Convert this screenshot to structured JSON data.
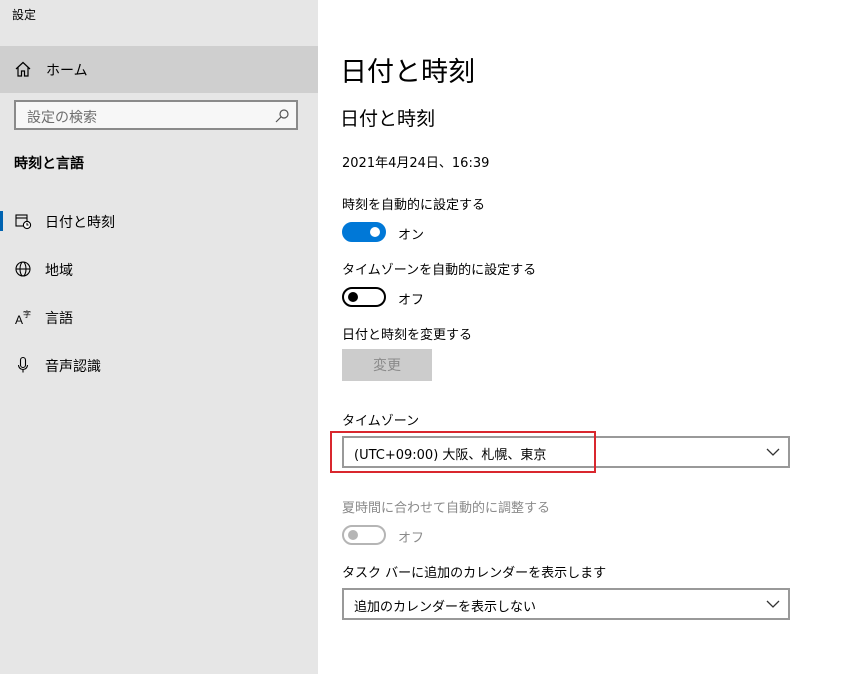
{
  "app": {
    "title": "設定"
  },
  "sidebar": {
    "home_label": "ホーム",
    "search_placeholder": "設定の検索",
    "section_title": "時刻と言語",
    "items": [
      {
        "label": "日付と時刻",
        "icon": "calendar-clock-icon",
        "selected": true
      },
      {
        "label": "地域",
        "icon": "globe-icon",
        "selected": false
      },
      {
        "label": "言語",
        "icon": "language-icon",
        "selected": false
      },
      {
        "label": "音声認識",
        "icon": "microphone-icon",
        "selected": false
      }
    ]
  },
  "main": {
    "page_title": "日付と時刻",
    "section_title": "日付と時刻",
    "current_datetime": "2021年4月24日、16:39",
    "auto_time": {
      "label": "時刻を自動的に設定する",
      "state": "オン",
      "on": true
    },
    "auto_timezone": {
      "label": "タイムゾーンを自動的に設定する",
      "state": "オフ",
      "on": false
    },
    "change_datetime": {
      "label": "日付と時刻を変更する",
      "button": "変更"
    },
    "timezone": {
      "label": "タイムゾーン",
      "value": "(UTC+09:00) 大阪、札幌、東京"
    },
    "dst": {
      "label": "夏時間に合わせて自動的に調整する",
      "state": "オフ",
      "on": false,
      "disabled": true
    },
    "extra_calendar": {
      "label": "タスク バーに追加のカレンダーを表示します",
      "value": "追加のカレンダーを表示しない"
    }
  },
  "colors": {
    "accent": "#0078d7",
    "highlight": "#d9272e",
    "sidebar_bg": "#e6e6e6"
  }
}
